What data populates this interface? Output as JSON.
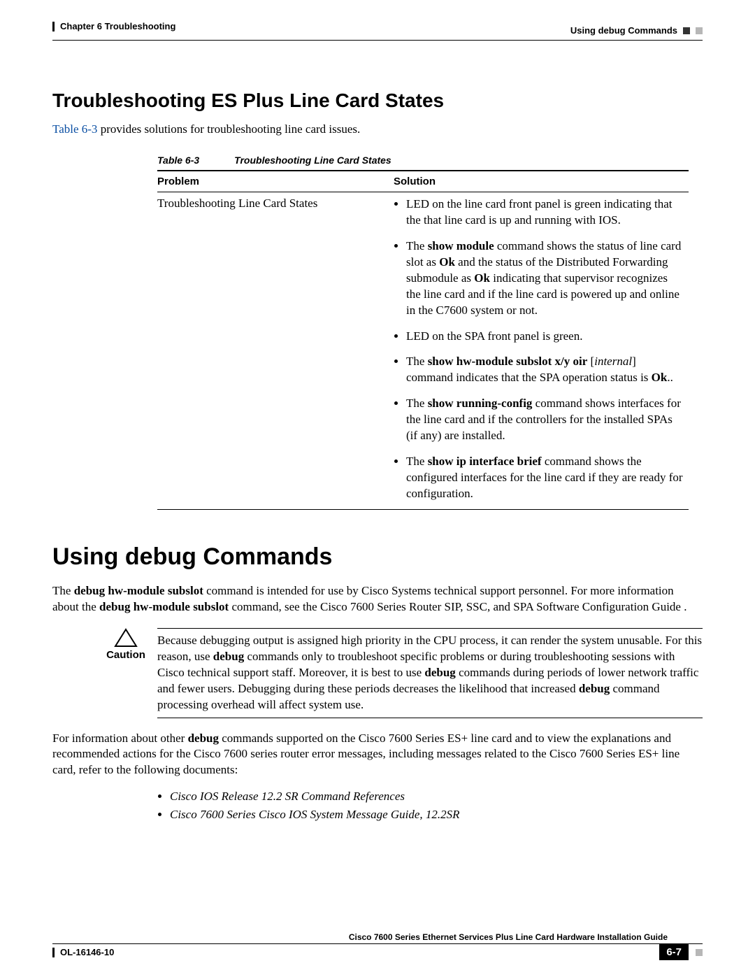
{
  "header": {
    "chapter": "Chapter 6    Troubleshooting",
    "section": "Using debug Commands"
  },
  "h2": "Troubleshooting ES Plus Line Card States",
  "intro_link": "Table 6-3",
  "intro_rest": " provides solutions for troubleshooting line card issues.",
  "table": {
    "caption_num": "Table 6-3",
    "caption_title": "Troubleshooting Line Card States",
    "head_problem": "Problem",
    "head_solution": "Solution",
    "problem": "Troubleshooting Line Card States",
    "sol": {
      "li1": "LED on the line card front panel is green indicating that the that line card is up and running with IOS.",
      "li2_a": "The ",
      "li2_b": "show module",
      "li2_c": " command shows the status of line card slot as ",
      "li2_d": "Ok",
      "li2_e": " and the status of the Distributed Forwarding submodule as ",
      "li2_f": "Ok",
      "li2_g": " indicating that supervisor recognizes the line card and if the line card is powered up and online in the C7600 system or not.",
      "li3": "LED on the SPA front panel is green.",
      "li4_a": "The ",
      "li4_b": "show hw-module subslot x/y oir",
      "li4_c": " [",
      "li4_d": "internal",
      "li4_e": "] command indicates that the SPA operation status is ",
      "li4_f": "Ok",
      "li4_g": "..",
      "li5_a": "The ",
      "li5_b": "show running-config",
      "li5_c": " command shows interfaces for the line card and if the controllers for the installed SPAs (if any) are installed.",
      "li6_a": "The ",
      "li6_b": "show ip interface brief",
      "li6_c": " command shows the configured interfaces for the line card if they are ready for configuration."
    }
  },
  "h1": "Using debug Commands",
  "para1_a": "The ",
  "para1_b": "debug hw-module subslot",
  "para1_c": " command is intended for use by Cisco Systems technical support personnel. For more information about the ",
  "para1_d": "debug hw-module subslot",
  "para1_e": " command, see the Cisco 7600 Series Router SIP, SSC, and SPA Software Configuration Guide .",
  "caution": {
    "label": "Caution",
    "a": "Because debugging output is assigned high priority in the CPU process, it can render the system unusable. For this reason, use ",
    "b": "debug",
    "c": " commands only to troubleshoot specific problems or during troubleshooting sessions with Cisco technical support staff. Moreover, it is best to use ",
    "d": "debug",
    "e": " commands during periods of lower network traffic and fewer users. Debugging during these periods decreases the likelihood that increased ",
    "f": "debug",
    "g": " command processing overhead will affect system use."
  },
  "para2_a": "For information about other ",
  "para2_b": "debug",
  "para2_c": " commands supported on the Cisco 7600 Series ES+ line card and to view the explanations and recommended actions for the Cisco 7600 series router error messages, including messages related to the Cisco 7600 Series ES+ line card, refer to the following documents:",
  "refs": {
    "r1": "Cisco IOS Release 12.2 SR Command References",
    "r2": "Cisco 7600 Series Cisco IOS System Message Guide, 12.2SR"
  },
  "footer": {
    "guide": "Cisco 7600 Series Ethernet Services Plus Line Card Hardware Installation Guide",
    "doc": "OL-16146-10",
    "page": "6-7"
  }
}
